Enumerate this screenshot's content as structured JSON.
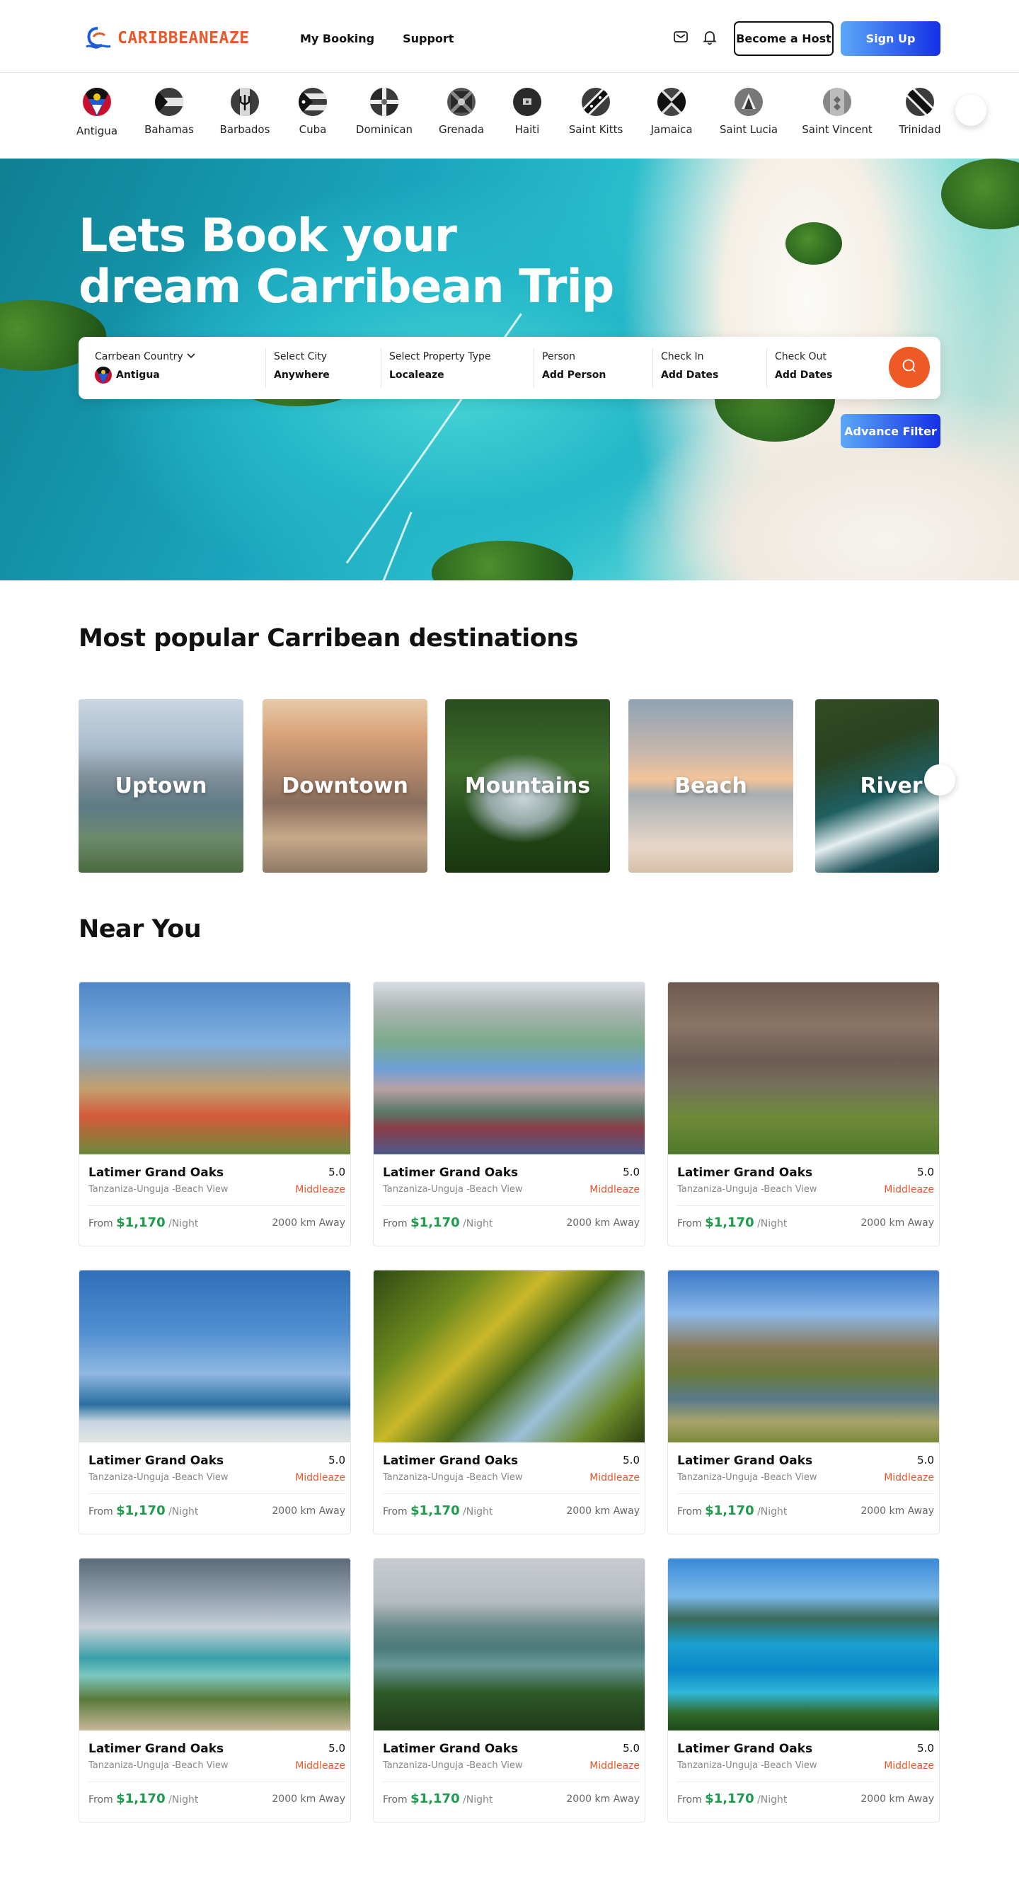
{
  "brand": {
    "name": "CARIBBEANEAZE"
  },
  "nav": {
    "my_booking": "My Booking",
    "support": "Support"
  },
  "header": {
    "become_host": "Become a Host",
    "sign_up": "Sign Up"
  },
  "countries": [
    {
      "name": "Antigua"
    },
    {
      "name": "Bahamas"
    },
    {
      "name": "Barbados"
    },
    {
      "name": "Cuba"
    },
    {
      "name": "Dominican"
    },
    {
      "name": "Grenada"
    },
    {
      "name": "Haiti"
    },
    {
      "name": "Saint Kitts"
    },
    {
      "name": "Jamaica"
    },
    {
      "name": "Saint Lucia"
    },
    {
      "name": "Saint Vincent"
    },
    {
      "name": "Trinidad"
    }
  ],
  "hero": {
    "title": "Lets Book your dream Carribean Trip",
    "search": {
      "country_label": "Carrbean Country",
      "country_value": "Antigua",
      "city_label": "Select City",
      "city_value": "Anywhere",
      "type_label": "Select Property Type",
      "type_value": "Localeaze",
      "person_label": "Person",
      "person_value": "Add Person",
      "checkin_label": "Check In",
      "checkin_value": "Add Dates",
      "checkout_label": "Check Out",
      "checkout_value": "Add Dates"
    },
    "advance_filter": "Advance Filter"
  },
  "popular": {
    "title": "Most popular Carribean destinations",
    "items": [
      {
        "label": "Uptown"
      },
      {
        "label": "Downtown"
      },
      {
        "label": "Mountains"
      },
      {
        "label": "Beach"
      },
      {
        "label": "River"
      }
    ]
  },
  "near": {
    "title": "Near You",
    "cards": [
      {
        "title": "Latimer Grand Oaks",
        "rating": "5.0",
        "location": "Tanzaniza-Unguja -Beach View",
        "tag": "Middleaze",
        "from": "From",
        "price": "$1,170",
        "per": "/Night",
        "distance": "2000 km Away"
      },
      {
        "title": "Latimer Grand Oaks",
        "rating": "5.0",
        "location": "Tanzaniza-Unguja -Beach View",
        "tag": "Middleaze",
        "from": "From",
        "price": "$1,170",
        "per": "/Night",
        "distance": "2000 km Away"
      },
      {
        "title": "Latimer Grand Oaks",
        "rating": "5.0",
        "location": "Tanzaniza-Unguja -Beach View",
        "tag": "Middleaze",
        "from": "From",
        "price": "$1,170",
        "per": "/Night",
        "distance": "2000 km Away"
      },
      {
        "title": "Latimer Grand Oaks",
        "rating": "5.0",
        "location": "Tanzaniza-Unguja -Beach View",
        "tag": "Middleaze",
        "from": "From",
        "price": "$1,170",
        "per": "/Night",
        "distance": "2000 km Away"
      },
      {
        "title": "Latimer Grand Oaks",
        "rating": "5.0",
        "location": "Tanzaniza-Unguja -Beach View",
        "tag": "Middleaze",
        "from": "From",
        "price": "$1,170",
        "per": "/Night",
        "distance": "2000 km Away"
      },
      {
        "title": "Latimer Grand Oaks",
        "rating": "5.0",
        "location": "Tanzaniza-Unguja -Beach View",
        "tag": "Middleaze",
        "from": "From",
        "price": "$1,170",
        "per": "/Night",
        "distance": "2000 km Away"
      },
      {
        "title": "Latimer Grand Oaks",
        "rating": "5.0",
        "location": "Tanzaniza-Unguja -Beach View",
        "tag": "Middleaze",
        "from": "From",
        "price": "$1,170",
        "per": "/Night",
        "distance": "2000 km Away"
      },
      {
        "title": "Latimer Grand Oaks",
        "rating": "5.0",
        "location": "Tanzaniza-Unguja -Beach View",
        "tag": "Middleaze",
        "from": "From",
        "price": "$1,170",
        "per": "/Night",
        "distance": "2000 km Away"
      },
      {
        "title": "Latimer Grand Oaks",
        "rating": "5.0",
        "location": "Tanzaniza-Unguja -Beach View",
        "tag": "Middleaze",
        "from": "From",
        "price": "$1,170",
        "per": "/Night",
        "distance": "2000 km Away"
      }
    ]
  },
  "icons": {
    "mail": "mail-icon",
    "bell": "bell-icon",
    "search": "search-icon",
    "chevron": "chevron-down-icon"
  },
  "colors": {
    "brand_orange": "#e85a2a",
    "accent_blue": "#1530e6",
    "price_green": "#1e9b4b"
  }
}
